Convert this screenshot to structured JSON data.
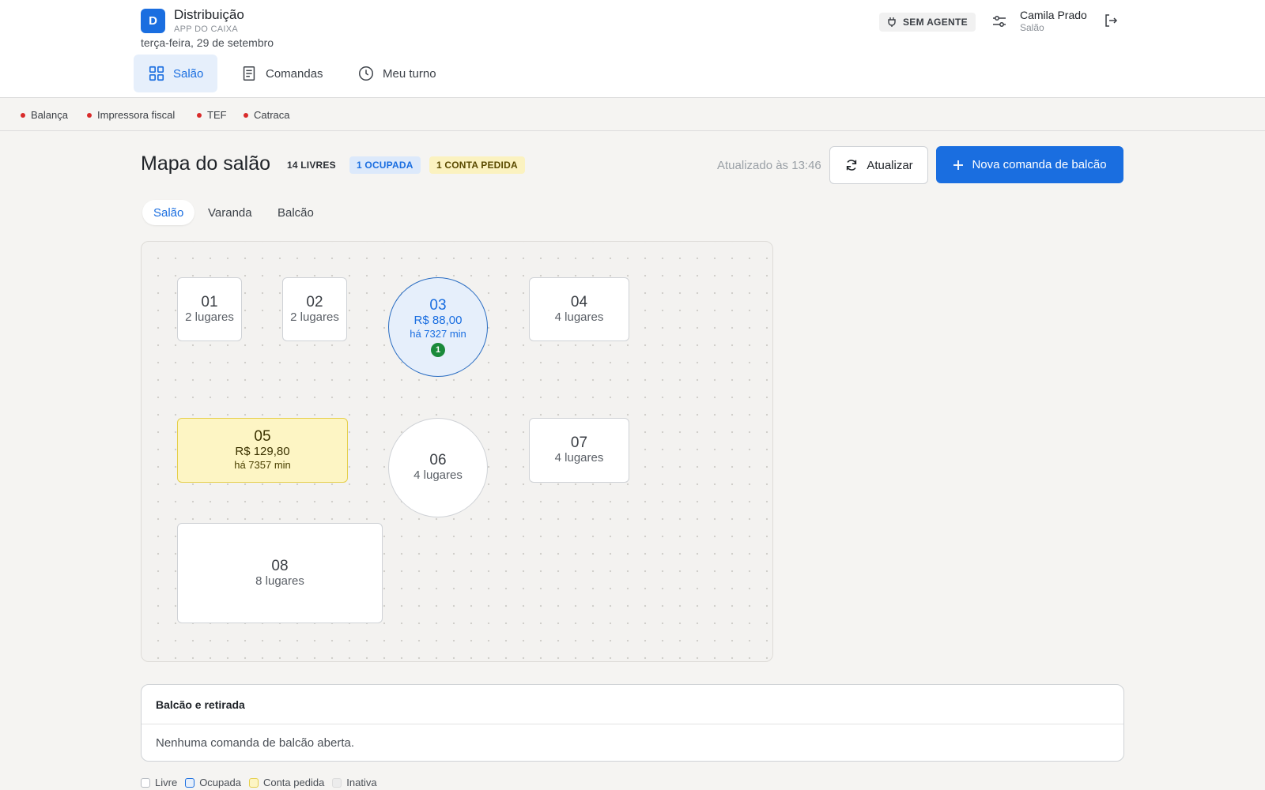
{
  "app": {
    "logo_letter": "D",
    "title": "Distribuição",
    "subtitle": "APP DO CAIXA",
    "date": "terça-feira, 29 de setembro"
  },
  "nav": {
    "tabs": [
      {
        "label": "Salão",
        "icon": "grid-icon",
        "active": true
      },
      {
        "label": "Comandas",
        "icon": "receipt-icon",
        "active": false
      },
      {
        "label": "Meu turno",
        "icon": "clock-icon",
        "active": false
      }
    ]
  },
  "agent": {
    "label": "SEM AGENTE",
    "icon": "plug-icon"
  },
  "user": {
    "name": "Camila Prado",
    "role": "Salão"
  },
  "devices": [
    {
      "label": "Balança",
      "status_color": "#d92b2b"
    },
    {
      "label": "Impressora fiscal",
      "status_color": "#d92b2b"
    },
    {
      "label": "TEF",
      "status_color": "#d92b2b"
    },
    {
      "label": "Catraca",
      "status_color": "#d92b2b"
    }
  ],
  "main": {
    "title": "Mapa do salão",
    "pills": {
      "free": "14 LIVRES",
      "occupied": "1 OCUPADA",
      "bill": "1 CONTA PEDIDA"
    },
    "updated": "Atualizado às 13:46",
    "refresh_label": "Atualizar",
    "new_label": "Nova comanda de balcão"
  },
  "areas": [
    {
      "label": "Salão",
      "active": true
    },
    {
      "label": "Varanda",
      "active": false
    },
    {
      "label": "Balcão",
      "active": false
    }
  ],
  "tables": [
    {
      "number": "01",
      "status": "livre",
      "shape": "square",
      "info": "2 lugares"
    },
    {
      "number": "02",
      "status": "livre",
      "shape": "square",
      "info": "2 lugares"
    },
    {
      "number": "03",
      "status": "ocupada",
      "shape": "round",
      "info": "R$ 88,00",
      "time": "há 7327 min",
      "guests": "1"
    },
    {
      "number": "04",
      "status": "livre",
      "shape": "rect",
      "info": "4 lugares"
    },
    {
      "number": "05",
      "status": "conta pedida",
      "shape": "rect",
      "info": "R$ 129,80",
      "time": "há 7357 min"
    },
    {
      "number": "06",
      "status": "livre",
      "shape": "round",
      "info": "4 lugares"
    },
    {
      "number": "07",
      "status": "livre",
      "shape": "rect",
      "info": "4 lugares"
    },
    {
      "number": "08",
      "status": "livre",
      "shape": "rect",
      "info": "8 lugares"
    }
  ],
  "counter": {
    "title": "Balcão e retirada",
    "empty_text": "Nenhuma comanda de balcão aberta."
  },
  "legend": [
    {
      "label": "Livre",
      "color": "#ffffff"
    },
    {
      "label": "Ocupada",
      "color": "#1a6ee0"
    },
    {
      "label": "Conta pedida",
      "color": "#e5cf4a"
    },
    {
      "label": "Inativa",
      "color": "#ececec"
    }
  ],
  "colors": {
    "accent": "#1a6ee0",
    "occupied_bg": "#e6effb",
    "bill_bg": "#fdf5c4",
    "device_error": "#d92b2b",
    "guest_badge": "#1a8a3a"
  }
}
